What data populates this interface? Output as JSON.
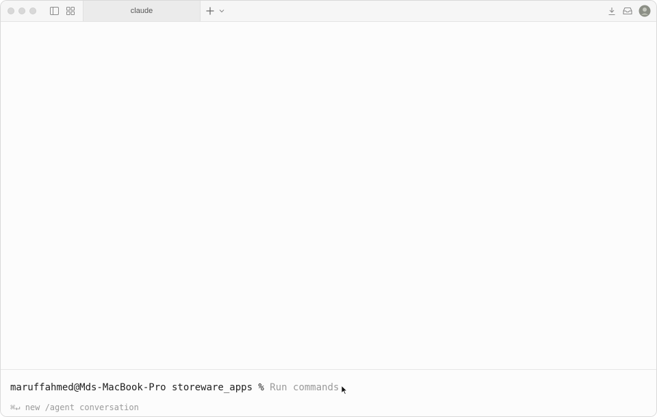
{
  "window": {
    "tab_title": "claude"
  },
  "titlebar": {
    "icons": [
      "close-icon",
      "minimize-icon",
      "zoom-icon",
      "sidebar-toggle-icon",
      "grid-view-icon",
      "plus-icon",
      "chevron-down-icon",
      "download-icon",
      "inbox-icon",
      "avatar"
    ]
  },
  "terminal": {
    "prompt": "maruffahmed@Mds-MacBook-Pro storeware_apps % ",
    "placeholder": "Run commands",
    "hint_shortcut": "⌘↵",
    "hint_text": "new /agent conversation"
  },
  "colors": {
    "background": "#fcfcfc",
    "titlebar": "#f6f6f6",
    "tab_active": "#ebebeb",
    "placeholder": "#9a9a9a",
    "text": "#1e1e1e"
  }
}
